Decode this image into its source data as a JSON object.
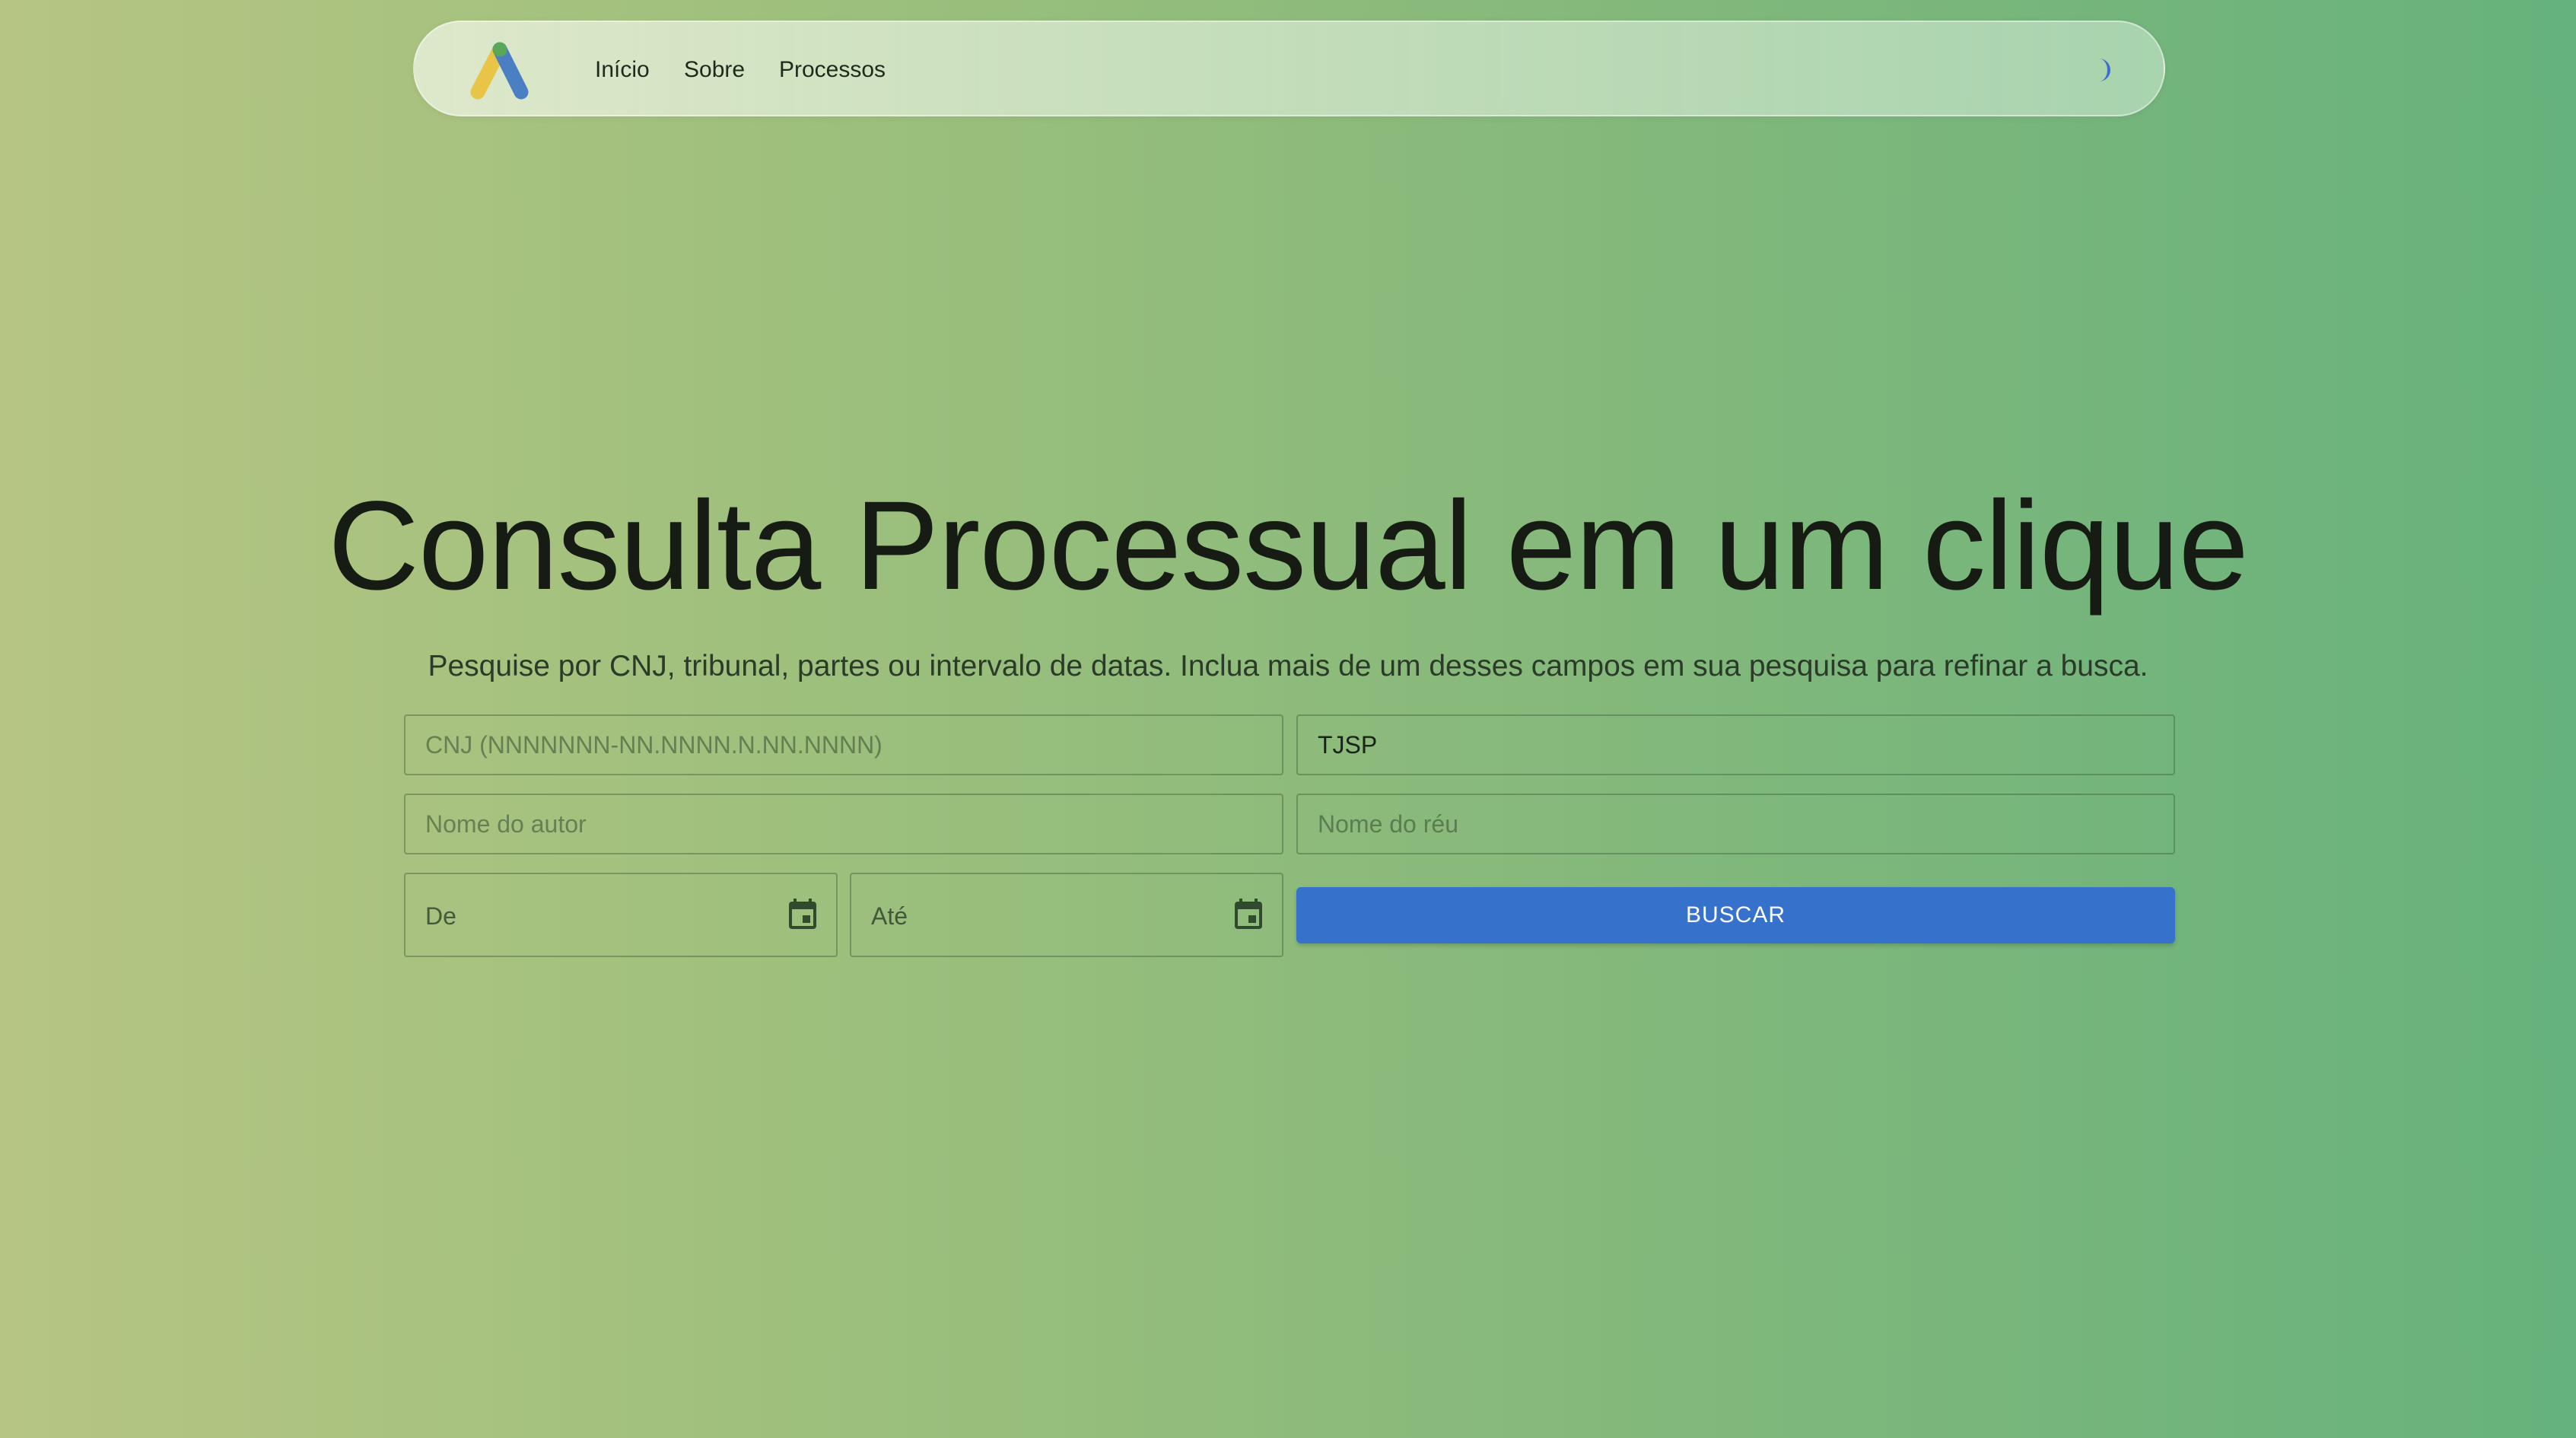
{
  "navbar": {
    "logo_icon": "brand-logo-icon",
    "links": [
      "Início",
      "Sobre",
      "Processos"
    ],
    "theme_toggle_icon": "moon-icon"
  },
  "hero": {
    "title": "Consulta Processual em um clique",
    "subtitle": "Pesquise por CNJ, tribunal, partes ou intervalo de datas. Inclua mais de um desses campos em sua pesquisa para refinar a busca."
  },
  "form": {
    "cnj": {
      "placeholder": "CNJ (NNNNNNN-NN.NNNN.N.NN.NNNN)",
      "value": ""
    },
    "tribunal": {
      "placeholder": "",
      "value": "TJSP"
    },
    "autor": {
      "placeholder": "Nome do autor",
      "value": ""
    },
    "reu": {
      "placeholder": "Nome do réu",
      "value": ""
    },
    "date_from": {
      "label": "De",
      "icon": "calendar-icon"
    },
    "date_to": {
      "label": "Até",
      "icon": "calendar-icon"
    },
    "submit_label": "BUSCAR"
  },
  "colors": {
    "accent": "#3672cb",
    "background_start": "#b6c583",
    "background_end": "#66b27c"
  }
}
